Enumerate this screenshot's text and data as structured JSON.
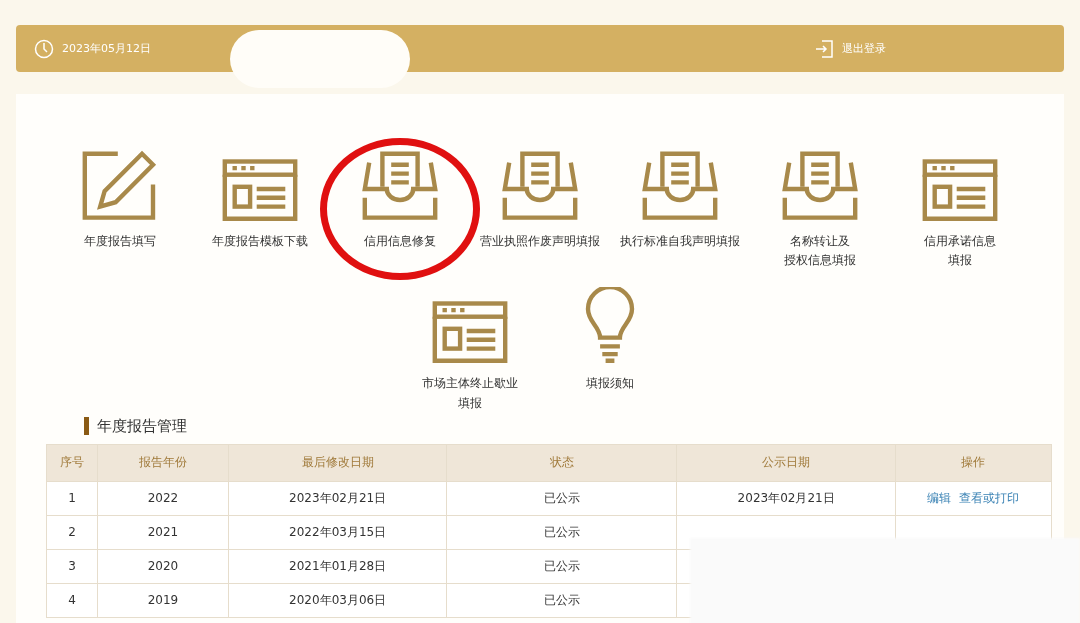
{
  "top_bar": {
    "date": "2023年05月12日",
    "logout": "退出登录"
  },
  "tiles": [
    {
      "kind": "pencil",
      "label": "年度报告填写",
      "highlighted": false
    },
    {
      "kind": "window",
      "label": "年度报告模板下载",
      "highlighted": false
    },
    {
      "kind": "inbox",
      "label": "信用信息修复",
      "highlighted": true
    },
    {
      "kind": "inbox",
      "label": "营业执照作废声明填报",
      "highlighted": false
    },
    {
      "kind": "inbox",
      "label": "执行标准自我声明填报",
      "highlighted": false
    },
    {
      "kind": "inbox",
      "label": "名称转让及",
      "label_2": "授权信息填报",
      "highlighted": false
    },
    {
      "kind": "window",
      "label": "信用承诺信息",
      "label_2": "填报",
      "highlighted": false
    },
    {
      "kind": "window",
      "label": "市场主体终止歇业",
      "label_2": "填报",
      "highlighted": false
    },
    {
      "kind": "bulb",
      "label": "填报须知",
      "highlighted": false
    }
  ],
  "section_title": "年度报告管理",
  "table": {
    "columns": [
      "序号",
      "报告年份",
      "最后修改日期",
      "状态",
      "公示日期",
      "操作"
    ],
    "rows": [
      {
        "cells": [
          "1",
          "2022",
          "2023年02月21日",
          "已公示",
          "2023年02月21日"
        ],
        "actions": [
          "编辑",
          "查看或打印"
        ]
      },
      {
        "cells": [
          "2",
          "2021",
          "2022年03月15日",
          "已公示"
        ],
        "actions": []
      },
      {
        "cells": [
          "3",
          "2020",
          "2021年01月28日",
          "已公示"
        ],
        "actions": []
      },
      {
        "cells": [
          "4",
          "2019",
          "2020年03月06日",
          "已公示"
        ],
        "actions": []
      }
    ]
  }
}
